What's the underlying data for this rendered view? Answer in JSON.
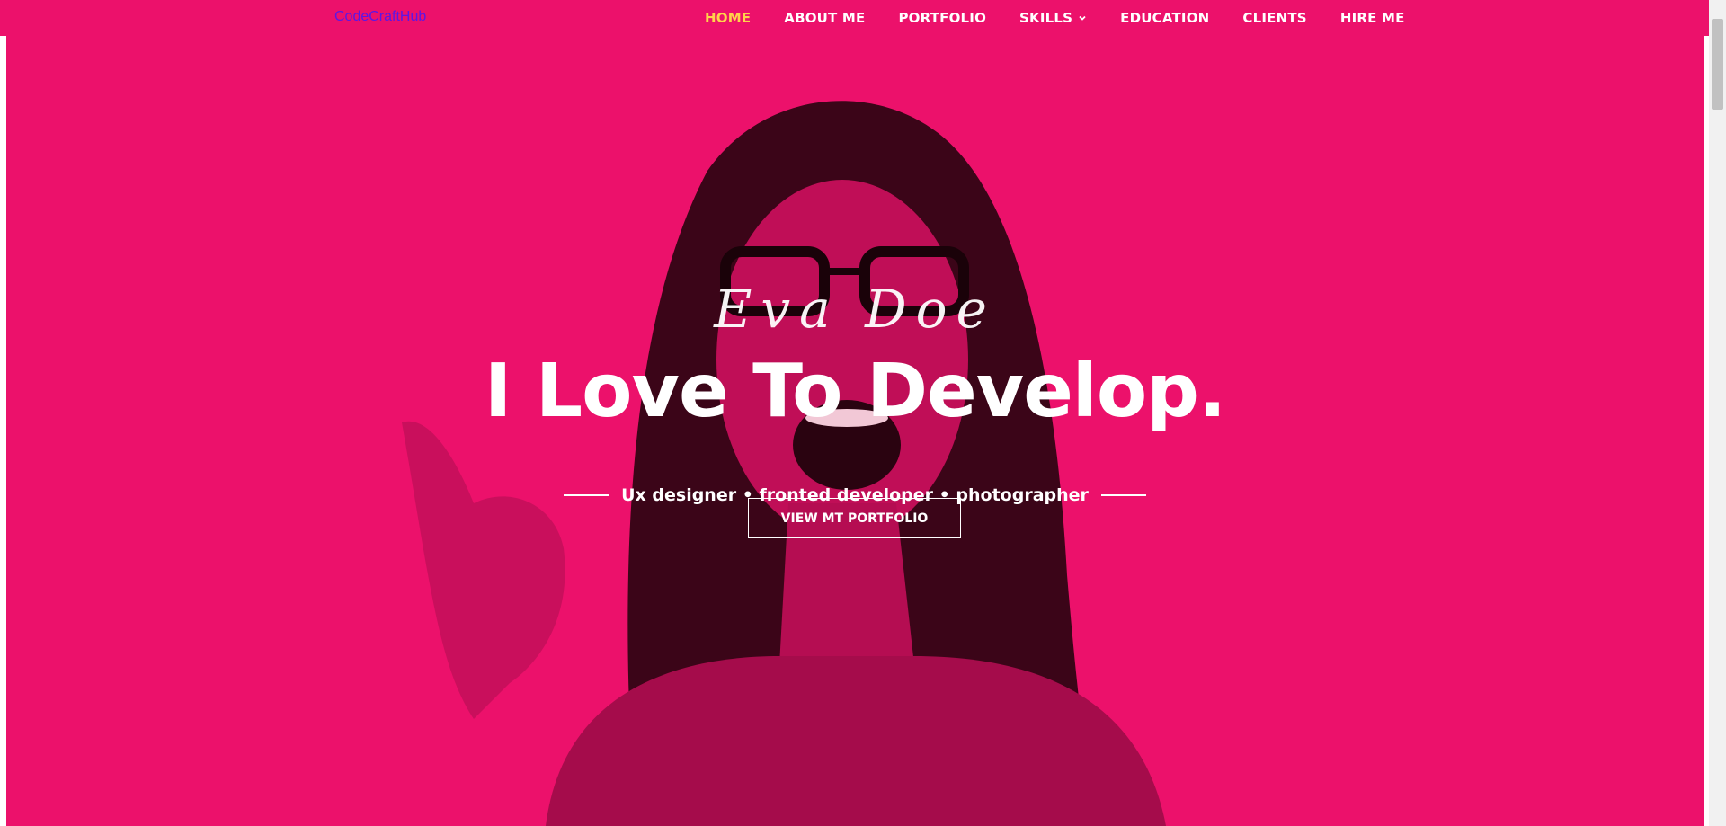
{
  "brand": {
    "name": "CodeCraftHub"
  },
  "nav": {
    "items": [
      {
        "label": "HOME",
        "active": true
      },
      {
        "label": "ABOUT ME"
      },
      {
        "label": "PORTFOLIO"
      },
      {
        "label": "SKILLS",
        "has_dropdown": true
      },
      {
        "label": "EDUCATION"
      },
      {
        "label": "CLIENTS"
      },
      {
        "label": "HIRE ME"
      }
    ]
  },
  "hero": {
    "signature": "Eva Doe",
    "headline": "I Love To Develop.",
    "tagline": "Ux designer • fronted developer • photographer",
    "cta_label": "VIEW MT PORTFOLIO"
  },
  "colors": {
    "primary": "#ec116b",
    "nav_active": "#ffd34a",
    "brand_text": "#5a17e6",
    "text": "#ffffff"
  },
  "icons": {
    "dropdown": "chevron-down-icon"
  }
}
